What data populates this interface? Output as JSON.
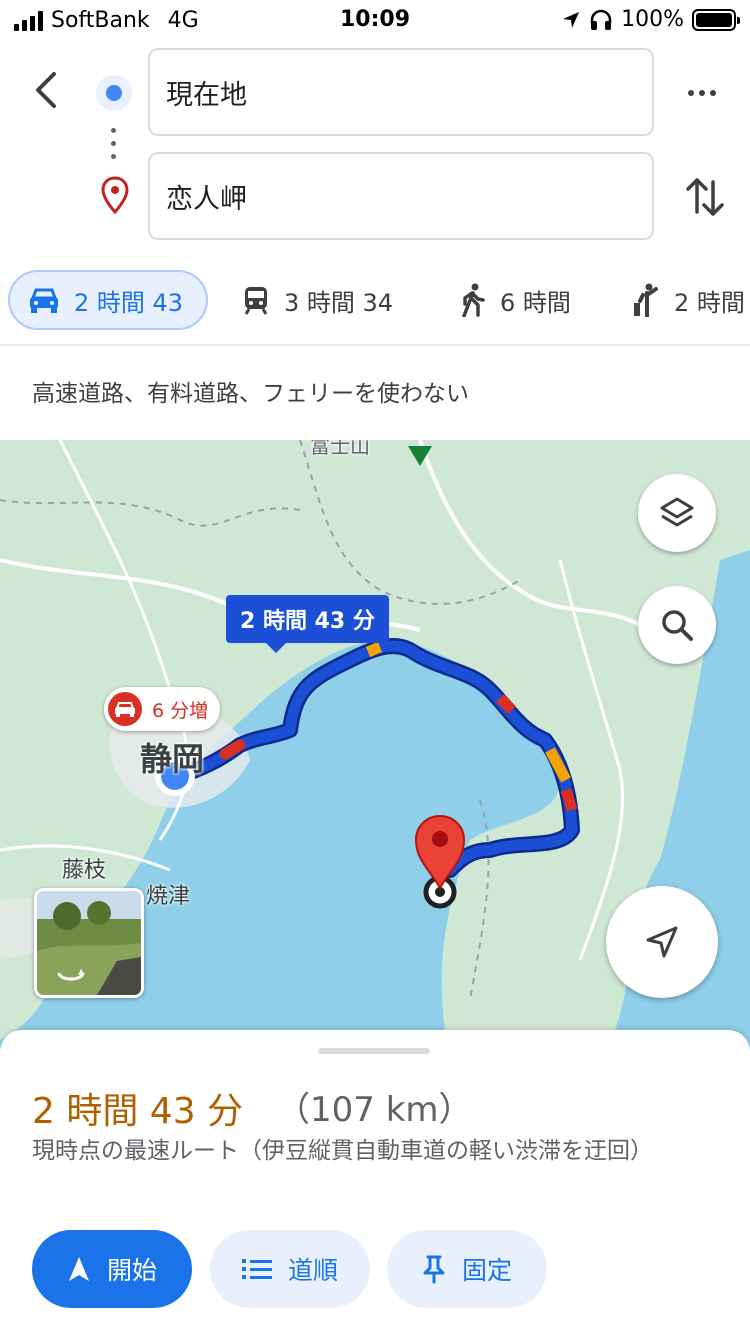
{
  "status_bar": {
    "carrier": "SoftBank",
    "network": "4G",
    "time": "10:09",
    "battery": "100%"
  },
  "search": {
    "origin_value": "現在地",
    "destination_value": "恋人岬"
  },
  "modes": [
    {
      "icon": "car-icon",
      "label": "2 時間 43",
      "selected": true
    },
    {
      "icon": "train-icon",
      "label": "3 時間 34",
      "selected": false
    },
    {
      "icon": "walk-icon",
      "label": "6 時間",
      "selected": false
    },
    {
      "icon": "ride-hail-icon",
      "label": "2 時間",
      "selected": false
    }
  ],
  "route_options": "高速道路、有料道路、フェリーを使わない",
  "map": {
    "route_time_label": "2 時間 43 分",
    "delay_label": "6 分増",
    "place_labels": {
      "shizuoka": "静岡",
      "fujieda": "藤枝",
      "yaizu": "焼津",
      "fujisan": "富士山"
    },
    "colors": {
      "route": "#1a4fd6",
      "traffic_slow": "#f4a300",
      "traffic_heavy": "#d93025",
      "water": "#8fcfea",
      "land": "#cfe8d4"
    }
  },
  "summary": {
    "duration": "2 時間 43 分",
    "distance": "（107 km）",
    "description": "現時点の最速ルート（伊豆縦貫自動車道の軽い渋滞を迂回）"
  },
  "actions": {
    "start": "開始",
    "steps": "道順",
    "pin": "固定"
  }
}
